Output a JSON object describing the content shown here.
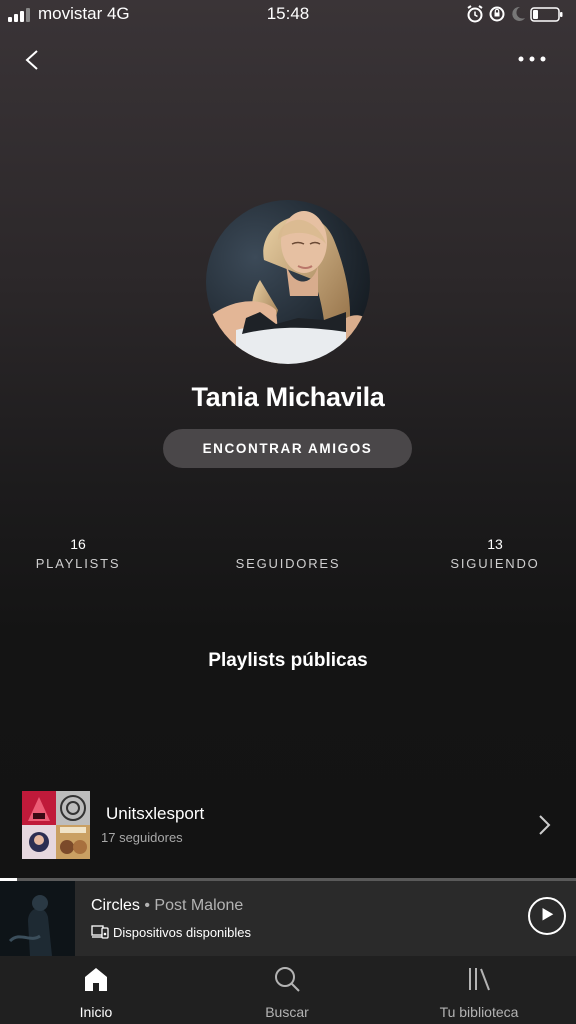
{
  "status_bar": {
    "carrier": "movistar",
    "network": "4G",
    "time": "15:48",
    "icons": [
      "alarm-icon",
      "orientation-lock-icon",
      "moon-icon",
      "battery-icon"
    ]
  },
  "header": {
    "back_icon": "chevron-left-icon",
    "more_icon": "more-horizontal-icon"
  },
  "profile": {
    "name": "Tania Michavila",
    "find_friends_label": "ENCONTRAR AMIGOS"
  },
  "stats": [
    {
      "value": "16",
      "label": "PLAYLISTS"
    },
    {
      "value": "",
      "label": "SEGUIDORES"
    },
    {
      "value": "13",
      "label": "SIGUIENDO"
    }
  ],
  "public_playlists": {
    "title": "Playlists públicas",
    "items": [
      {
        "name": "Unitsxlesport",
        "followers": "17 seguidores"
      }
    ]
  },
  "now_playing": {
    "title": "Circles",
    "separator": " • ",
    "artist": "Post Malone",
    "devices_label": "Dispositivos disponibles",
    "progress": 0.03
  },
  "bottom_nav": [
    {
      "label": "Inicio",
      "icon": "home-icon",
      "active": true
    },
    {
      "label": "Buscar",
      "icon": "search-icon",
      "active": false
    },
    {
      "label": "Tu biblioteca",
      "icon": "library-icon",
      "active": false
    }
  ],
  "colors": {
    "active_nav": "#ffffff",
    "inactive_nav": "#b3b3b3",
    "button_bg": "#4a4749"
  }
}
